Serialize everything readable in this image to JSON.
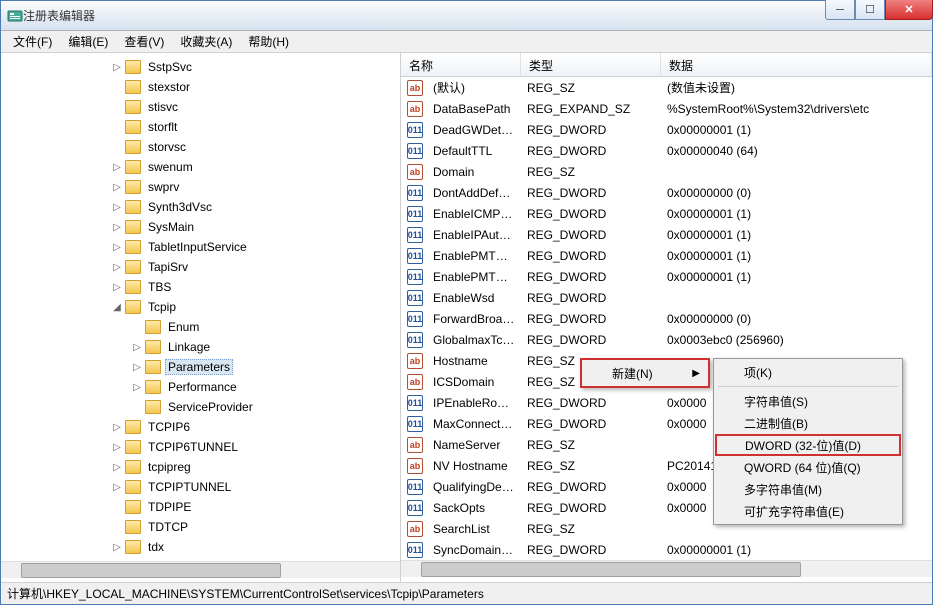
{
  "window": {
    "title": "注册表编辑器"
  },
  "menu": {
    "file": "文件(F)",
    "edit": "编辑(E)",
    "view": "查看(V)",
    "fav": "收藏夹(A)",
    "help": "帮助(H)"
  },
  "tree": [
    {
      "l": 1,
      "exp": "▷",
      "label": "SstpSvc"
    },
    {
      "l": 1,
      "exp": "",
      "label": "stexstor"
    },
    {
      "l": 1,
      "exp": "",
      "label": "stisvc"
    },
    {
      "l": 1,
      "exp": "",
      "label": "storflt"
    },
    {
      "l": 1,
      "exp": "",
      "label": "storvsc"
    },
    {
      "l": 1,
      "exp": "▷",
      "label": "swenum"
    },
    {
      "l": 1,
      "exp": "▷",
      "label": "swprv"
    },
    {
      "l": 1,
      "exp": "▷",
      "label": "Synth3dVsc"
    },
    {
      "l": 1,
      "exp": "▷",
      "label": "SysMain"
    },
    {
      "l": 1,
      "exp": "▷",
      "label": "TabletInputService"
    },
    {
      "l": 1,
      "exp": "▷",
      "label": "TapiSrv"
    },
    {
      "l": 1,
      "exp": "▷",
      "label": "TBS"
    },
    {
      "l": 1,
      "exp": "◢",
      "label": "Tcpip"
    },
    {
      "l": 2,
      "exp": "",
      "label": "Enum"
    },
    {
      "l": 2,
      "exp": "▷",
      "label": "Linkage"
    },
    {
      "l": 2,
      "exp": "▷",
      "label": "Parameters",
      "sel": true
    },
    {
      "l": 2,
      "exp": "▷",
      "label": "Performance"
    },
    {
      "l": 2,
      "exp": "",
      "label": "ServiceProvider"
    },
    {
      "l": 1,
      "exp": "▷",
      "label": "TCPIP6"
    },
    {
      "l": 1,
      "exp": "▷",
      "label": "TCPIP6TUNNEL"
    },
    {
      "l": 1,
      "exp": "▷",
      "label": "tcpipreg"
    },
    {
      "l": 1,
      "exp": "▷",
      "label": "TCPIPTUNNEL"
    },
    {
      "l": 1,
      "exp": "",
      "label": "TDPIPE"
    },
    {
      "l": 1,
      "exp": "",
      "label": "TDTCP"
    },
    {
      "l": 1,
      "exp": "▷",
      "label": "tdx"
    }
  ],
  "columns": {
    "name": "名称",
    "type": "类型",
    "data": "数据"
  },
  "values": [
    {
      "icon": "sz",
      "name": "(默认)",
      "type": "REG_SZ",
      "data": "(数值未设置)"
    },
    {
      "icon": "sz",
      "name": "DataBasePath",
      "type": "REG_EXPAND_SZ",
      "data": "%SystemRoot%\\System32\\drivers\\etc"
    },
    {
      "icon": "dw",
      "name": "DeadGWDetec...",
      "type": "REG_DWORD",
      "data": "0x00000001 (1)"
    },
    {
      "icon": "dw",
      "name": "DefaultTTL",
      "type": "REG_DWORD",
      "data": "0x00000040 (64)"
    },
    {
      "icon": "sz",
      "name": "Domain",
      "type": "REG_SZ",
      "data": ""
    },
    {
      "icon": "dw",
      "name": "DontAddDefau...",
      "type": "REG_DWORD",
      "data": "0x00000000 (0)"
    },
    {
      "icon": "dw",
      "name": "EnableICMPRe...",
      "type": "REG_DWORD",
      "data": "0x00000001 (1)"
    },
    {
      "icon": "dw",
      "name": "EnableIPAutoC...",
      "type": "REG_DWORD",
      "data": "0x00000001 (1)"
    },
    {
      "icon": "dw",
      "name": "EnablePMTUB...",
      "type": "REG_DWORD",
      "data": "0x00000001 (1)"
    },
    {
      "icon": "dw",
      "name": "EnablePMTUDi...",
      "type": "REG_DWORD",
      "data": "0x00000001 (1)"
    },
    {
      "icon": "dw",
      "name": "EnableWsd",
      "type": "REG_DWORD",
      "data": ""
    },
    {
      "icon": "dw",
      "name": "ForwardBroad...",
      "type": "REG_DWORD",
      "data": "0x00000000 (0)"
    },
    {
      "icon": "dw",
      "name": "GlobalmaxTcp ...",
      "type": "REG_DWORD",
      "data": "0x0003ebc0 (256960)"
    },
    {
      "icon": "sz",
      "name": "Hostname",
      "type": "REG_SZ",
      "data": ""
    },
    {
      "icon": "sz",
      "name": "ICSDomain",
      "type": "REG_SZ",
      "data": ""
    },
    {
      "icon": "dw",
      "name": "IPEnableRouter",
      "type": "REG_DWORD",
      "data": "0x0000"
    },
    {
      "icon": "dw",
      "name": "MaxConnectio...",
      "type": "REG_DWORD",
      "data": "0x0000"
    },
    {
      "icon": "sz",
      "name": "NameServer",
      "type": "REG_SZ",
      "data": ""
    },
    {
      "icon": "sz",
      "name": "NV Hostname",
      "type": "REG_SZ",
      "data": "PC20141"
    },
    {
      "icon": "dw",
      "name": "QualifyingDesti...",
      "type": "REG_DWORD",
      "data": "0x0000"
    },
    {
      "icon": "dw",
      "name": "SackOpts",
      "type": "REG_DWORD",
      "data": "0x0000"
    },
    {
      "icon": "sz",
      "name": "SearchList",
      "type": "REG_SZ",
      "data": ""
    },
    {
      "icon": "dw",
      "name": "SyncDomainWi...",
      "type": "REG_DWORD",
      "data": "0x00000001 (1)"
    }
  ],
  "context1": {
    "new": "新建(N)"
  },
  "context2": {
    "key": "项(K)",
    "string": "字符串值(S)",
    "binary": "二进制值(B)",
    "dword": "DWORD (32-位)值(D)",
    "qword": "QWORD (64 位)值(Q)",
    "multi": "多字符串值(M)",
    "expand": "可扩充字符串值(E)"
  },
  "status": "计算机\\HKEY_LOCAL_MACHINE\\SYSTEM\\CurrentControlSet\\services\\Tcpip\\Parameters"
}
